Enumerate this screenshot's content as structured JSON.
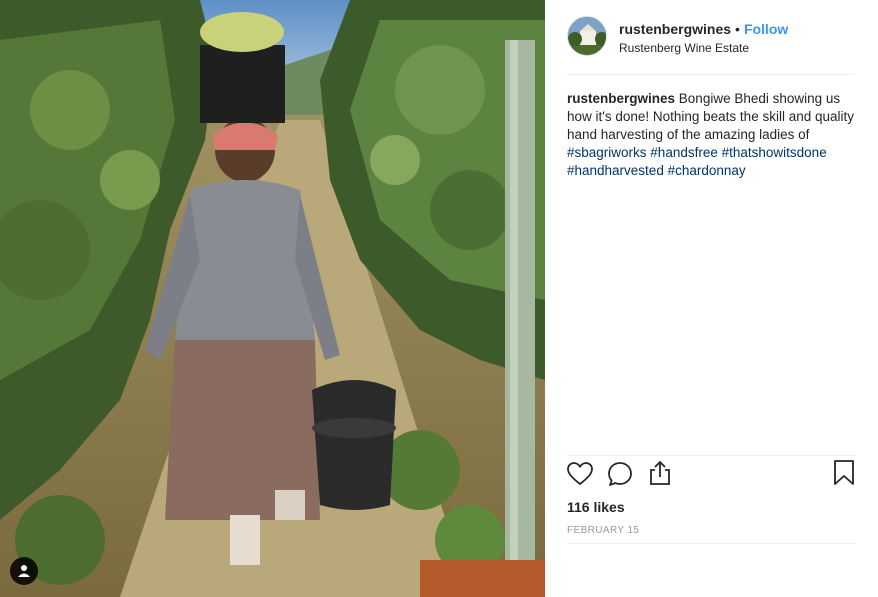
{
  "post": {
    "username": "rustenbergwines",
    "separator": "•",
    "follow_label": "Follow",
    "location": "Rustenberg Wine Estate",
    "caption_user": "rustenbergwines",
    "caption_text": "Bongiwe Bhedi showing us how it's done! Nothing beats the skill and quality hand harvesting of the amazing ladies of",
    "hashtags": [
      "#sbagriworks",
      "#handsfree",
      "#thatshowitsdone",
      "#handharvested",
      "#chardonnay"
    ],
    "likes": "116 likes",
    "date": "FEBRUARY 15"
  },
  "icons": {
    "like": "heart-icon",
    "comment": "comment-icon",
    "share": "share-icon",
    "save": "bookmark-icon",
    "user_tag": "user-icon"
  },
  "colors": {
    "link": "#3897f0",
    "hashtag": "#003569",
    "muted": "#999999"
  }
}
